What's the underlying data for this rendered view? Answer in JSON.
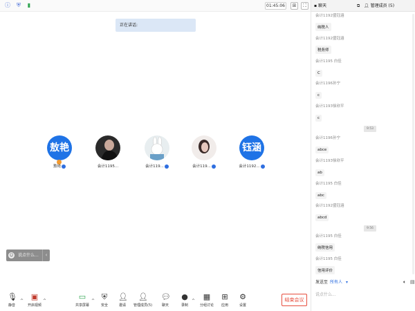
{
  "topbar": {
    "time": "01:45:06"
  },
  "speaking_label": "正在讲话:",
  "participants": [
    {
      "name": "敖艳",
      "avatar_text": "敖艳"
    },
    {
      "name": "会计1195..."
    },
    {
      "name": "会计119..."
    },
    {
      "name": "会计119..."
    },
    {
      "name": "会计1192...",
      "avatar_text": "钰涵"
    }
  ],
  "chat_float": {
    "placeholder": "说点什么..."
  },
  "toolbar": {
    "mute": "静音",
    "video": "开启视频",
    "share": "共享屏幕",
    "security": "安全",
    "invite": "邀请",
    "members": "管理成员(5)",
    "chat": "聊天",
    "record": "录制",
    "breakout": "分组讨论",
    "apps": "应用",
    "settings": "设置",
    "end": "结束会议"
  },
  "sidebar": {
    "tab_chat": "聊天",
    "tab_members": "管理成员 (5)",
    "messages": [
      {
        "sender": "会计1192盛钰涵",
        "text": "纳税人"
      },
      {
        "sender": "会计1192盛钰涵",
        "text": "税务师"
      },
      {
        "sender": "会计1195 白佳",
        "text": "C"
      },
      {
        "sender": "会计1196孙宁",
        "text": "c"
      },
      {
        "sender": "会计1193徐欣平",
        "text": "c"
      },
      {
        "sender": "会计1196孙宁",
        "text": "abce"
      },
      {
        "sender": "会计1193徐欣平",
        "text": "ab"
      },
      {
        "sender": "会计1195 白佳",
        "text": "abc"
      },
      {
        "sender": "会计1192盛钰涵",
        "text": "abcd"
      },
      {
        "sender": "会计1195 白佳",
        "text": "纳税信用"
      },
      {
        "sender": "会计1195 白佳",
        "text": "信用评价"
      }
    ],
    "timestamps": [
      "9:53",
      "9:56"
    ],
    "send_to_label": "发送至",
    "send_to_target": "所有人",
    "compose_placeholder": "说点什么..."
  }
}
